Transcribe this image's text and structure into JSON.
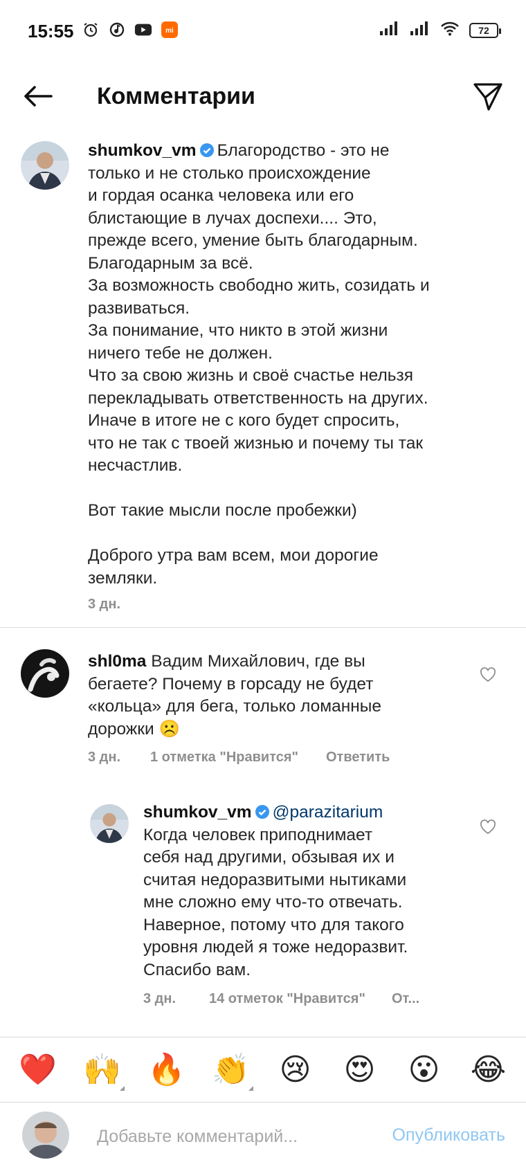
{
  "status_bar": {
    "time": "15:55",
    "battery": "72",
    "icons": [
      "alarm-icon",
      "music-icon",
      "youtube-icon",
      "mi-app-icon",
      "signal-icon",
      "signal-icon",
      "wifi-icon"
    ]
  },
  "header": {
    "title": "Комментарии",
    "back_icon": "arrow-left-icon",
    "send_icon": "direct-send-icon"
  },
  "comments": [
    {
      "username": "shumkov_vm",
      "verified": true,
      "text": "Благородство - это не\nтолько и не столько происхождение\nи гордая осанка человека или его\nблистающие в лучах доспехи.... Это,\nпрежде всего, умение быть благодарным.\nБлагодарным за всё.\nЗа возможность свободно жить, созидать и\nразвиваться.\nЗа понимание, что никто в этой жизни\nничего тебе не должен.\nЧто за свою жизнь и своё счастье нельзя\nперекладывать ответственность на других.\nИначе в итоге не с кого будет спросить,\nчто не так с твоей жизнью и почему ты так\nнесчастлив.\n\nВот такие мысли после пробежки)\n\nДоброго утра вам всем, мои дорогие\nземляки.",
      "time": "3 дн."
    },
    {
      "username": "shl0ma",
      "verified": false,
      "text": "Вадим Михайлович, где вы\nбегаете? Почему в горсаду не будет\n«кольца» для бега, только ломанные\nдорожки",
      "emoji": "☹️",
      "time": "3 дн.",
      "likes": "1 отметка \"Нравится\"",
      "reply": "Ответить"
    },
    {
      "username": "shumkov_vm",
      "verified": true,
      "mention": "@parazitarium",
      "text": "Когда человек приподнимает\nсебя над другими, обзывая их и\nсчитая недоразвитыми нытиками\nмне сложно ему что-то отвечать.\nНаверное, потому что для такого\nуровня людей я тоже недоразвит.\nСпасибо вам.",
      "time": "3 дн.",
      "likes": "14 отметок \"Нравится\"",
      "reply": "От..."
    }
  ],
  "emoji_bar": [
    "❤️",
    "🙌",
    "🔥",
    "👏",
    "😢",
    "😍",
    "😮",
    "😂"
  ],
  "composer": {
    "placeholder": "Добавьте комментарий...",
    "publish": "Опубликовать"
  }
}
